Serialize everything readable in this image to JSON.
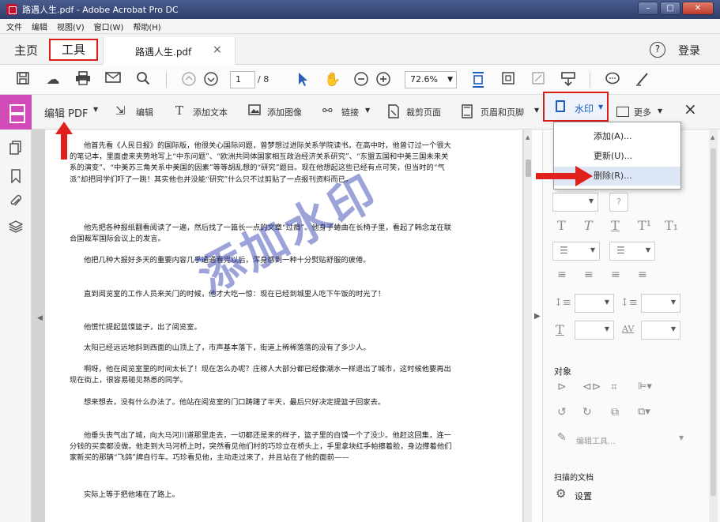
{
  "window": {
    "title": "路遇人生.pdf - Adobe Acrobat Pro DC"
  },
  "menubar": {
    "items": [
      "文件",
      "编辑",
      "视图(V)",
      "窗口(W)",
      "帮助(H)"
    ]
  },
  "tabs": {
    "home": "主页",
    "tools": "工具",
    "file": "路遇人生.pdf",
    "file_close": "×"
  },
  "account": {
    "help": "?",
    "login": "登录"
  },
  "toolbar": {
    "page_current": "1",
    "page_total": "/ 8",
    "zoom": "72.6%"
  },
  "edit_toolbar": {
    "edit_pdf": "编辑 PDF",
    "edit": "编辑",
    "add_text": "添加文本",
    "add_image": "添加图像",
    "link": "链接",
    "crop": "裁剪页面",
    "header_footer": "页眉和页脚",
    "watermark": "水印",
    "more": "更多",
    "close": "×"
  },
  "watermark_menu": {
    "items": [
      "添加(A)...",
      "更新(U)...",
      "删除(R)..."
    ],
    "highlighted_index": 2
  },
  "document": {
    "watermark_text": "添加水印",
    "paragraphs": [
      "他首先看《人民日报》的国际版，他很关心国际问题，曾梦想过进际关系学院读书。在高中时，他曾订过一个很大的笔记本，里面虚来夹势地写上“中东问题”、“欧洲共同体国家相互政治经济关系研究”、“东盟五国和中美三国未来关系的演变”、“中美苏三角关系中美国的因素”等等胡乱想的“研究”题目。现在他想起这些已经有点可笑，但当时的“气派”却把同学们吓了一跳！其实他也并没能“研究”什么只不过剪贴了一点报刊资料而已。",
      "他先把各种报纸翻看阅读了一遍，然后找了一篇长一点的文章“过瘾”。他身子蜷曲在长椅子里，看起了韩念龙在联合国裁军国际会议上的发言。",
      "他把几种大报好多天的重要内容几乎通通看完以后，浑身感到一种十分熨贴舒服的疲倦。",
      "直到阅览室的工作人员来关门的时候，他才大吃一惊：现在已经到城里人吃下午饭的时光了！",
      "他慌忙提起蓝馍篮子，出了阅览室。",
      "太阳已经远远地斜到西面的山顶上了，市声基本落下，街道上稀稀落落的没有了多少人。",
      "啊呀，他在阅览室里的时间太长了！现在怎么办呢？庄稼人大部分都已经像潮水一样退出了城市，这时候他要再出现在街上，很容易碰见熟悉的同学。",
      "想来想去，没有什么办法了。他站在阅览室的门口踌躇了半天，最后只好决定提篮子回家去。",
      "他垂头丧气出了城，向大马河川道那里走去，一切都还是来的样子，篮子里的白馍一个了没少。他赶这回集，连一分钱的买卖都没做。他走到大马河桥上时，突然看见他们村的巧珍立在桥头上，手里拿块红手帕擦着脸，身边撑着他们家新买的那辆“飞鸽”牌自行车。巧珍看见他，主动走过来了，并且站在了他的面前——",
      "实际上等于把他堵在了路上。"
    ]
  },
  "right_panel": {
    "objects_label": "对象",
    "edit_tool": "编辑工具...",
    "scanned_label": "扫描的文档",
    "settings": "设置"
  }
}
